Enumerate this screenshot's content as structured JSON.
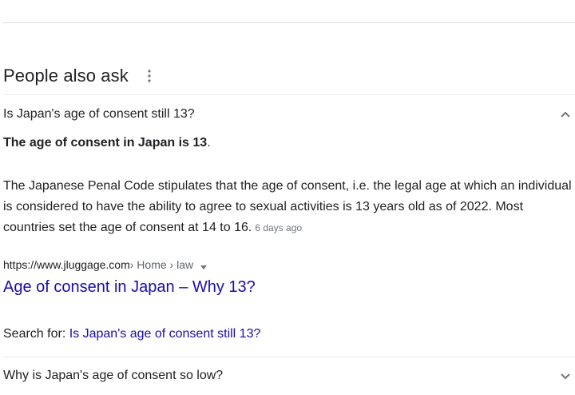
{
  "paa": {
    "title": "People also ask"
  },
  "questions": [
    {
      "text": "Is Japan's age of consent still 13?",
      "expanded": true,
      "answer": {
        "headline_bold": "The age of consent in Japan is 13",
        "headline_end": ".",
        "body": "The Japanese Penal Code stipulates that the age of consent, i.e. the legal age at which an individual is considered to have the ability to agree to sexual activities is 13 years old as of 2022. Most countries set the age of consent at 14 to 16.",
        "date": "6 days ago",
        "source": {
          "url": "https://www.jluggage.com",
          "breadcrumb": " › Home › law",
          "title": "Age of consent in Japan – Why 13?"
        },
        "search_for_label": "Search for:",
        "search_for_query": "Is Japan's age of consent still 13?"
      }
    },
    {
      "text": "Why is Japan's age of consent so low?",
      "expanded": false
    }
  ],
  "colors": {
    "link": "#1a0dab",
    "text": "#202124",
    "muted": "#70757a",
    "divider": "#e8eaed"
  },
  "icons": {
    "more": "more-vert-icon",
    "collapse": "chevron-up-icon",
    "expand": "chevron-down-icon",
    "cite_menu": "caret-down-icon"
  }
}
